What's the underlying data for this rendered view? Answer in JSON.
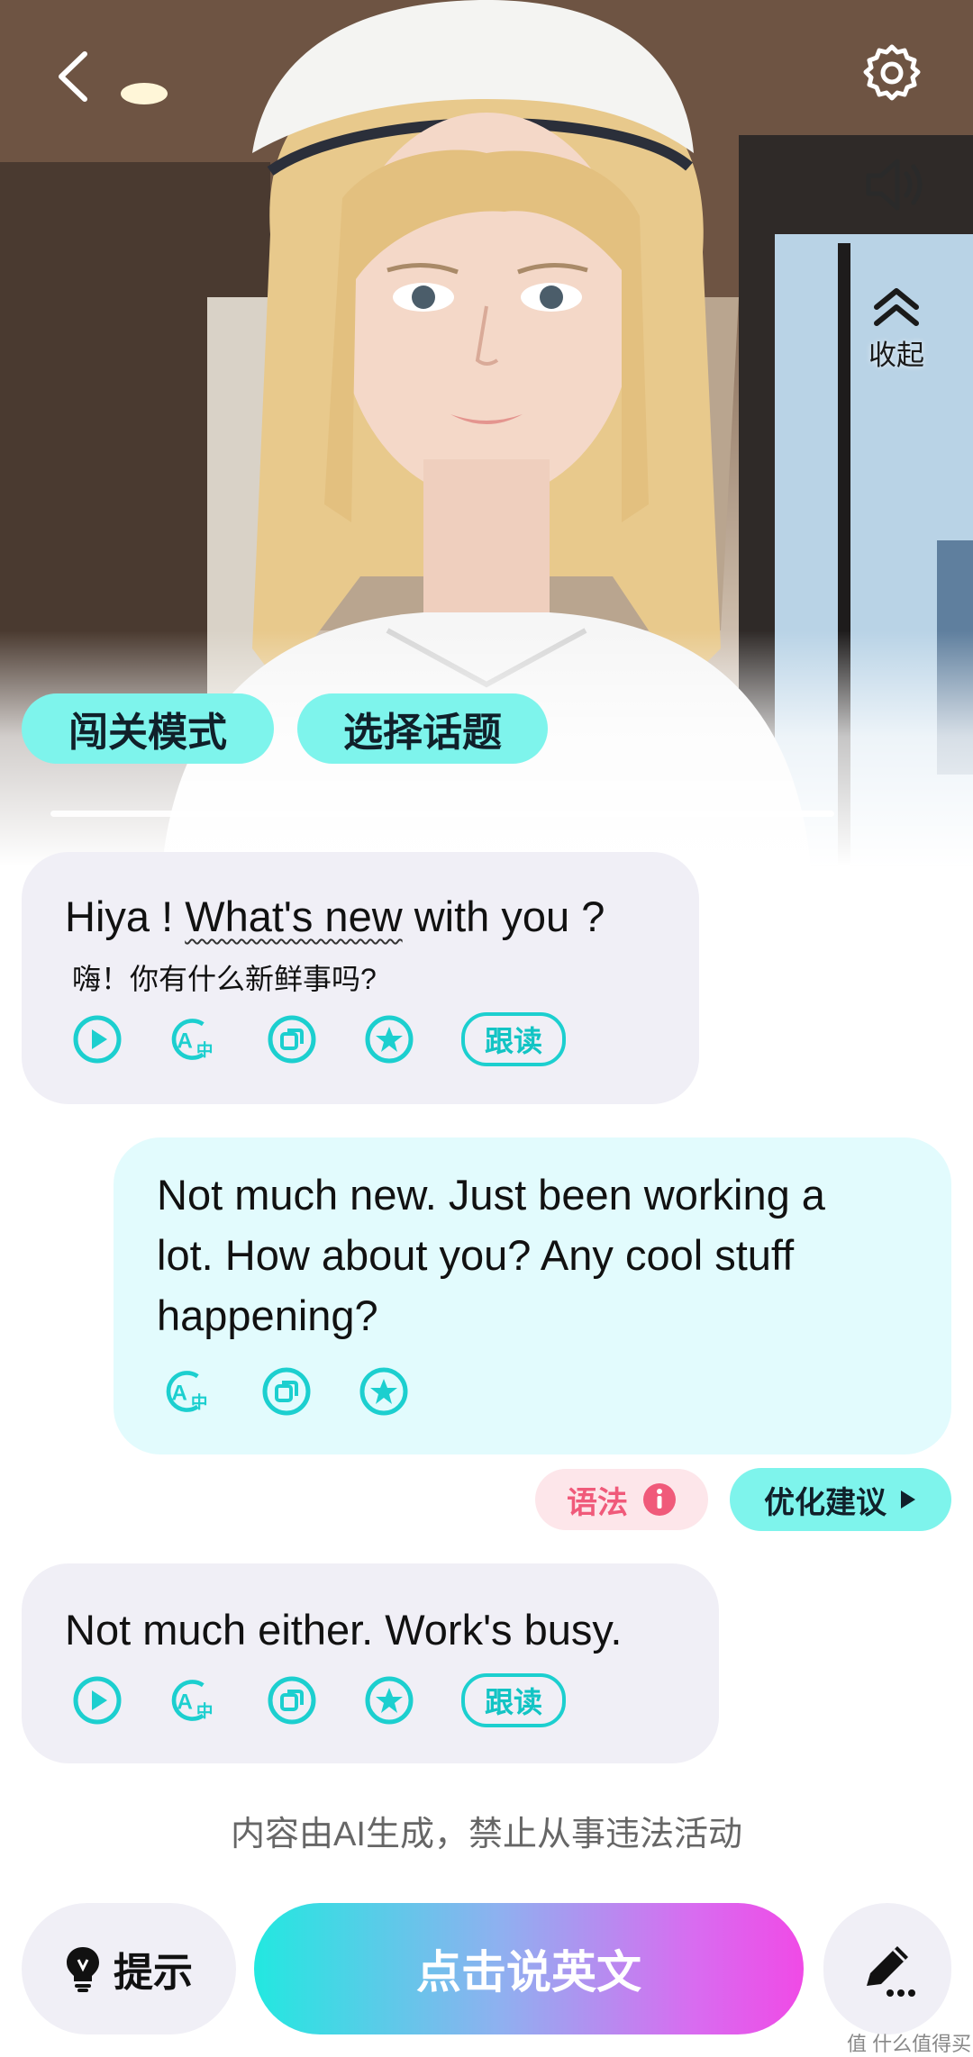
{
  "header": {
    "back_icon": "chevron-left-icon",
    "settings_icon": "gear-icon",
    "speaker_icon": "speaker-icon",
    "collapse_icon": "double-chevron-up-icon",
    "collapse_label": "收起"
  },
  "mode_buttons": {
    "challenge_label": "闯关模式",
    "topic_label": "选择话题"
  },
  "messages": [
    {
      "role": "ai",
      "text_before": "Hiya ! ",
      "text_highlight": "What's new",
      "text_after": " with you ?",
      "translation": "嗨！你有什么新鲜事吗?",
      "follow_label": "跟读"
    },
    {
      "role": "user",
      "lines": [
        "Not much new. Just been working a",
        "lot. How about you? Any cool stuff",
        "happening?"
      ]
    },
    {
      "role": "ai",
      "text": "Not much either. Work's busy.",
      "follow_label": "跟读"
    }
  ],
  "feedback": {
    "grammar_label": "语法",
    "suggest_label": "优化建议"
  },
  "disclaimer": "内容由AI生成，禁止从事违法活动",
  "bottom": {
    "hint_label": "提示",
    "speak_label": "点击说英文",
    "edit_icon": "pencil-icon"
  },
  "watermark": "值 什么值得买",
  "colors": {
    "accent_cyan": "#7ef4ec",
    "icon_cyan": "#1ccfcf",
    "ai_bubble": "#f0eff6",
    "user_bubble": "#e2fbfd",
    "grammar_pink": "#f05a7a"
  }
}
